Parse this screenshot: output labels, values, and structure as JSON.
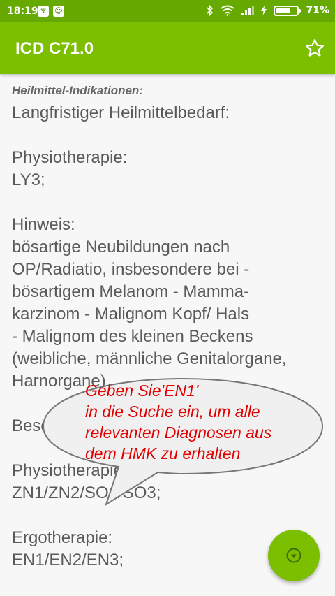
{
  "status_bar": {
    "time": "18:19",
    "battery_text": "71%",
    "battery_level": 0.71,
    "icons": [
      "shield-app-icon",
      "robot-app-icon",
      "bluetooth-icon",
      "wifi-icon",
      "signal-icon",
      "charging-icon",
      "battery-icon"
    ]
  },
  "app_bar": {
    "title": "ICD C71.0",
    "action_icon": "star-outline-icon",
    "color": "#7cbe00"
  },
  "content": {
    "heading": "Heilmittel-Indikationen:",
    "body": "Langfristiger Heilmittelbedarf:\n\nPhysiotherapie:\nLY3;\n\nHinweis:\nbösartige Neubildungen nach\nOP/Radiatio, insbesondere bei -\nbösartigem Melanom - Mamma-\nkarzinom - Malignom Kopf/ Hals\n-  Malignom des kleinen Beckens\n(weibliche, männliche Genitalorgane,\nHarnorgane)\n\nBesondere Verordnungsbedarf:\n\nPhysiotherapie:\nZN1/ZN2/SO1/SO3;\n\nErgotherapie:\nEN1/EN2/EN3;"
  },
  "tooltip": {
    "text": "Geben Sie'EN1'\nin die Suche ein, um alle\nrelevanten Diagnosen aus\ndem HMK zu erhalten",
    "text_color": "#e00000"
  },
  "fab": {
    "icon": "chevron-down-circle-icon"
  }
}
